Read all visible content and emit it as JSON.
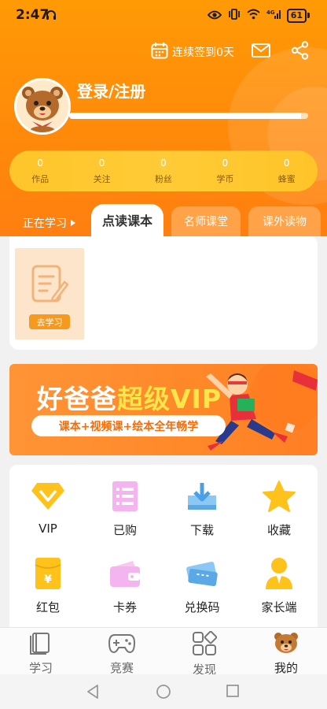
{
  "status_bar": {
    "time": "2:47",
    "battery": "61"
  },
  "header": {
    "checkin_label": "连续签到0天",
    "login_label": "登录/注册",
    "level_progress": 0.97
  },
  "stats": [
    {
      "value": "0",
      "label": "作品"
    },
    {
      "value": "0",
      "label": "关注"
    },
    {
      "value": "0",
      "label": "粉丝"
    },
    {
      "value": "0",
      "label": "学币"
    },
    {
      "value": "0",
      "label": "蜂蜜"
    }
  ],
  "learning": {
    "label": "正在学习",
    "tabs": [
      "点读课本",
      "名师课堂",
      "课外读物"
    ],
    "active_tab": 0,
    "course_button": "去学习"
  },
  "banner": {
    "title_part1": "好爸爸",
    "title_part2": "超级VIP",
    "subtitle": "课本+视频课+绘本全年畅学"
  },
  "grid": [
    {
      "label": "VIP",
      "icon": "vip-icon"
    },
    {
      "label": "已购",
      "icon": "purchased-icon"
    },
    {
      "label": "下载",
      "icon": "download-icon"
    },
    {
      "label": "收藏",
      "icon": "star-icon"
    },
    {
      "label": "红包",
      "icon": "red-packet-icon"
    },
    {
      "label": "卡券",
      "icon": "wallet-icon"
    },
    {
      "label": "兑换码",
      "icon": "ticket-icon"
    },
    {
      "label": "家长端",
      "icon": "parent-icon"
    }
  ],
  "bottom_nav": [
    {
      "label": "学习",
      "icon": "book-icon"
    },
    {
      "label": "竞赛",
      "icon": "gamepad-icon"
    },
    {
      "label": "发现",
      "icon": "discover-icon"
    },
    {
      "label": "我的",
      "icon": "bear-icon"
    }
  ],
  "colors": {
    "brand_orange": "#ff8a0a",
    "stats_yellow": "#ffc52a",
    "vip_yellow": "#ffe44a"
  }
}
